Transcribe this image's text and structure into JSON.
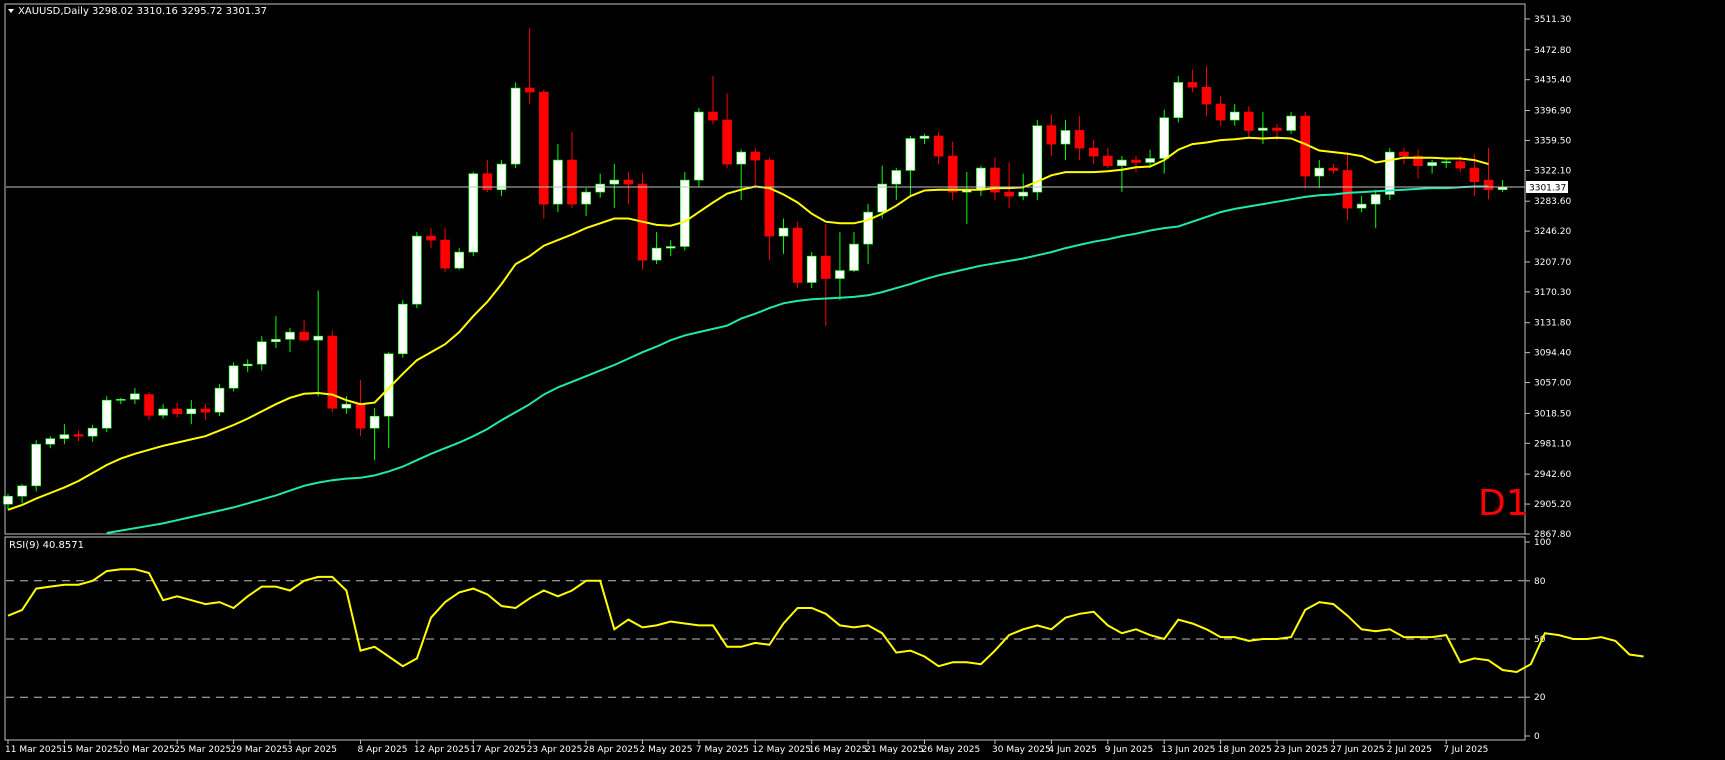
{
  "window": {
    "symbol_header": "XAUUSD,Daily 3298.02 3310.16 3295.72 3301.37",
    "timeframe_badge": "D1"
  },
  "colors": {
    "background": "#000000",
    "bull_body": "#ffffff",
    "bear_body": "#ff0000",
    "wick_bull": "#00ff00",
    "wick_bear": "#ff0000",
    "ma_fast": "#ffff00",
    "ma_slow": "#20e8b0",
    "grid_axis": "#c0c0c0",
    "price_line": "#c0c0c0",
    "rsi_line": "#ffff00",
    "badge": "#ff0000"
  },
  "chart_data": [
    {
      "type": "candlestick",
      "title": "XAUUSD,Daily",
      "current_price": 3301.37,
      "last_bar": {
        "open": 3298.02,
        "high": 3310.16,
        "low": 3295.72,
        "close": 3301.37
      },
      "ylim": [
        2867.8,
        3530
      ],
      "price_ticks": [
        "3511.30",
        "3472.80",
        "3435.40",
        "3396.90",
        "3359.50",
        "3322.10",
        "3283.60",
        "3246.20",
        "3207.70",
        "3170.30",
        "3131.80",
        "3094.40",
        "3057.00",
        "3018.50",
        "2981.10",
        "2942.60",
        "2905.20",
        "2867.80"
      ],
      "x_labels": [
        "11 Mar 2025",
        "15 Mar 2025",
        "20 Mar 2025",
        "25 Mar 2025",
        "29 Mar 2025",
        "3 Apr 2025",
        "8 Apr 2025",
        "12 Apr 2025",
        "17 Apr 2025",
        "23 Apr 2025",
        "28 Apr 2025",
        "2 May 2025",
        "7 May 2025",
        "12 May 2025",
        "16 May 2025",
        "21 May 2025",
        "26 May 2025",
        "30 May 2025",
        "4 Jun 2025",
        "9 Jun 2025",
        "13 Jun 2025",
        "18 Jun 2025",
        "23 Jun 2025",
        "27 Jun 2025",
        "2 Jul 2025",
        "7 Jul 2025"
      ],
      "candles": [
        [
          2905,
          2918,
          2898,
          2915
        ],
        [
          2915,
          2930,
          2906,
          2928
        ],
        [
          2928,
          2985,
          2921,
          2980
        ],
        [
          2980,
          2990,
          2975,
          2987
        ],
        [
          2987,
          3005,
          2980,
          2992
        ],
        [
          2992,
          2997,
          2984,
          2990
        ],
        [
          2990,
          3004,
          2983,
          3000
        ],
        [
          3000,
          3040,
          2995,
          3035
        ],
        [
          3035,
          3038,
          3030,
          3036
        ],
        [
          3036,
          3050,
          3030,
          3043
        ],
        [
          3042,
          3045,
          3010,
          3016
        ],
        [
          3016,
          3030,
          3012,
          3024
        ],
        [
          3024,
          3032,
          3014,
          3018
        ],
        [
          3018,
          3035,
          3005,
          3024
        ],
        [
          3024,
          3030,
          3010,
          3020
        ],
        [
          3020,
          3055,
          3015,
          3050
        ],
        [
          3050,
          3082,
          3046,
          3078
        ],
        [
          3078,
          3086,
          3070,
          3080
        ],
        [
          3080,
          3115,
          3072,
          3108
        ],
        [
          3108,
          3140,
          3100,
          3111
        ],
        [
          3111,
          3125,
          3095,
          3120
        ],
        [
          3120,
          3135,
          3115,
          3110
        ],
        [
          3110,
          3172,
          3040,
          3115
        ],
        [
          3115,
          3122,
          3020,
          3025
        ],
        [
          3025,
          3040,
          3018,
          3030
        ],
        [
          3030,
          3060,
          2990,
          3000
        ],
        [
          3000,
          3025,
          2960,
          3015
        ],
        [
          3015,
          3095,
          2975,
          3093
        ],
        [
          3093,
          3160,
          3088,
          3155
        ],
        [
          3155,
          3245,
          3150,
          3240
        ],
        [
          3240,
          3250,
          3225,
          3235
        ],
        [
          3235,
          3250,
          3195,
          3200
        ],
        [
          3200,
          3225,
          3198,
          3220
        ],
        [
          3220,
          3320,
          3215,
          3318
        ],
        [
          3318,
          3335,
          3295,
          3298
        ],
        [
          3298,
          3335,
          3290,
          3330
        ],
        [
          3330,
          3432,
          3325,
          3425
        ],
        [
          3425,
          3500,
          3405,
          3420
        ],
        [
          3420,
          3423,
          3262,
          3280
        ],
        [
          3280,
          3355,
          3270,
          3335
        ],
        [
          3335,
          3370,
          3275,
          3280
        ],
        [
          3280,
          3300,
          3265,
          3295
        ],
        [
          3295,
          3318,
          3288,
          3305
        ],
        [
          3305,
          3330,
          3275,
          3310
        ],
        [
          3310,
          3320,
          3280,
          3305
        ],
        [
          3305,
          3318,
          3198,
          3210
        ],
        [
          3210,
          3245,
          3205,
          3225
        ],
        [
          3225,
          3235,
          3215,
          3227
        ],
        [
          3227,
          3320,
          3222,
          3310
        ],
        [
          3310,
          3400,
          3302,
          3395
        ],
        [
          3395,
          3440,
          3380,
          3385
        ],
        [
          3385,
          3418,
          3325,
          3330
        ],
        [
          3330,
          3348,
          3285,
          3345
        ],
        [
          3345,
          3350,
          3300,
          3335
        ],
        [
          3335,
          3338,
          3210,
          3240
        ],
        [
          3240,
          3262,
          3218,
          3250
        ],
        [
          3250,
          3258,
          3175,
          3182
        ],
        [
          3182,
          3220,
          3175,
          3215
        ],
        [
          3215,
          3255,
          3128,
          3187
        ],
        [
          3187,
          3245,
          3160,
          3197
        ],
        [
          3197,
          3245,
          3195,
          3230
        ],
        [
          3230,
          3280,
          3205,
          3270
        ],
        [
          3270,
          3328,
          3262,
          3305
        ],
        [
          3305,
          3325,
          3285,
          3322
        ],
        [
          3322,
          3365,
          3290,
          3362
        ],
        [
          3362,
          3368,
          3355,
          3365
        ],
        [
          3365,
          3370,
          3330,
          3340
        ],
        [
          3340,
          3358,
          3285,
          3295
        ],
        [
          3295,
          3320,
          3255,
          3298
        ],
        [
          3298,
          3328,
          3290,
          3325
        ],
        [
          3325,
          3338,
          3285,
          3295
        ],
        [
          3295,
          3332,
          3275,
          3290
        ],
        [
          3290,
          3318,
          3285,
          3295
        ],
        [
          3295,
          3385,
          3285,
          3378
        ],
        [
          3378,
          3392,
          3340,
          3355
        ],
        [
          3355,
          3385,
          3335,
          3372
        ],
        [
          3372,
          3390,
          3335,
          3350
        ],
        [
          3350,
          3360,
          3330,
          3340
        ],
        [
          3340,
          3350,
          3325,
          3328
        ],
        [
          3328,
          3340,
          3295,
          3335
        ],
        [
          3335,
          3340,
          3320,
          3332
        ],
        [
          3332,
          3348,
          3325,
          3337
        ],
        [
          3337,
          3398,
          3318,
          3388
        ],
        [
          3388,
          3440,
          3382,
          3432
        ],
        [
          3432,
          3448,
          3420,
          3426
        ],
        [
          3426,
          3452,
          3390,
          3405
        ],
        [
          3405,
          3415,
          3378,
          3385
        ],
        [
          3385,
          3405,
          3378,
          3395
        ],
        [
          3395,
          3402,
          3362,
          3372
        ],
        [
          3372,
          3395,
          3355,
          3375
        ],
        [
          3375,
          3380,
          3360,
          3372
        ],
        [
          3372,
          3395,
          3368,
          3390
        ],
        [
          3390,
          3395,
          3300,
          3315
        ],
        [
          3315,
          3335,
          3300,
          3325
        ],
        [
          3325,
          3330,
          3318,
          3322
        ],
        [
          3322,
          3345,
          3260,
          3275
        ],
        [
          3275,
          3290,
          3270,
          3280
        ],
        [
          3280,
          3298,
          3250,
          3292
        ],
        [
          3292,
          3350,
          3285,
          3345
        ],
        [
          3345,
          3350,
          3330,
          3340
        ],
        [
          3340,
          3348,
          3312,
          3328
        ],
        [
          3328,
          3335,
          3318,
          3332
        ],
        [
          3332,
          3338,
          3325,
          3333
        ],
        [
          3333,
          3340,
          3320,
          3325
        ],
        [
          3325,
          3342,
          3290,
          3308
        ],
        [
          3310,
          3350,
          3286,
          3298
        ],
        [
          3298,
          3310,
          3295,
          3301
        ]
      ],
      "ma_fast_values": [
        2898,
        2904,
        2912,
        2919,
        2926,
        2934,
        2944,
        2954,
        2962,
        2968,
        2973,
        2978,
        2982,
        2986,
        2990,
        2997,
        3004,
        3012,
        3021,
        3030,
        3038,
        3043,
        3044,
        3042,
        3035,
        3030,
        3032,
        3050,
        3068,
        3085,
        3095,
        3105,
        3120,
        3140,
        3158,
        3180,
        3205,
        3215,
        3228,
        3235,
        3242,
        3250,
        3256,
        3262,
        3262,
        3258,
        3254,
        3253,
        3258,
        3270,
        3282,
        3293,
        3298,
        3302,
        3300,
        3292,
        3282,
        3268,
        3258,
        3256,
        3256,
        3260,
        3268,
        3278,
        3290,
        3297,
        3298,
        3298,
        3298,
        3298,
        3300,
        3300,
        3301,
        3308,
        3316,
        3320,
        3320,
        3320,
        3321,
        3323,
        3326,
        3327,
        3335,
        3348,
        3355,
        3357,
        3360,
        3361,
        3363,
        3362,
        3363,
        3362,
        3355,
        3347,
        3345,
        3343,
        3340,
        3332,
        3335,
        3338,
        3338,
        3338,
        3337,
        3337,
        3335,
        3330
      ],
      "ma_slow_values": [
        2855,
        2857,
        2858,
        2860,
        2862,
        2864,
        2866,
        2869,
        2872,
        2875,
        2878,
        2881,
        2885,
        2889,
        2893,
        2897,
        2901,
        2906,
        2911,
        2916,
        2922,
        2928,
        2932,
        2935,
        2937,
        2938,
        2941,
        2946,
        2952,
        2960,
        2968,
        2975,
        2982,
        2990,
        2999,
        3010,
        3020,
        3030,
        3042,
        3051,
        3058,
        3065,
        3072,
        3079,
        3087,
        3095,
        3102,
        3110,
        3116,
        3120,
        3124,
        3128,
        3137,
        3143,
        3150,
        3156,
        3159,
        3161,
        3162,
        3163,
        3164,
        3166,
        3170,
        3175,
        3180,
        3186,
        3191,
        3195,
        3199,
        3203,
        3206,
        3209,
        3212,
        3216,
        3220,
        3225,
        3229,
        3233,
        3236,
        3240,
        3243,
        3247,
        3250,
        3252,
        3258,
        3264,
        3270,
        3274,
        3277,
        3280,
        3283,
        3286,
        3289,
        3291,
        3292,
        3294,
        3295,
        3296,
        3297,
        3298,
        3299,
        3300,
        3300,
        3301,
        3302,
        3302
      ]
    },
    {
      "type": "line",
      "title": "RSI(9) 40.8571",
      "ylim": [
        0,
        100
      ],
      "ticks": [
        "100",
        "80",
        "50",
        "20",
        "0"
      ],
      "levels": [
        80,
        50,
        20
      ],
      "values": [
        62,
        65,
        76,
        77,
        78,
        78,
        80,
        85,
        86,
        86,
        84,
        70,
        72,
        70,
        68,
        69,
        66,
        72,
        77,
        77,
        75,
        80,
        82,
        82,
        75,
        44,
        46,
        41,
        36,
        40,
        61,
        69,
        74,
        76,
        73,
        67,
        66,
        71,
        75,
        72,
        75,
        80,
        80,
        55,
        60,
        56,
        57,
        59,
        58,
        57,
        57,
        46,
        46,
        48,
        47,
        58,
        66,
        66,
        63,
        57,
        56,
        57,
        53,
        43,
        44,
        41,
        36,
        38,
        38,
        37,
        44,
        52,
        55,
        57,
        55,
        61,
        63,
        64,
        57,
        53,
        55,
        52,
        50,
        60,
        58,
        55,
        51,
        51,
        49,
        50,
        50,
        51,
        65,
        69,
        68,
        62,
        55,
        54,
        55,
        51,
        51,
        51,
        52,
        38,
        40,
        39,
        34,
        33,
        37,
        53,
        52,
        50,
        50,
        51,
        49,
        42,
        41
      ]
    }
  ]
}
